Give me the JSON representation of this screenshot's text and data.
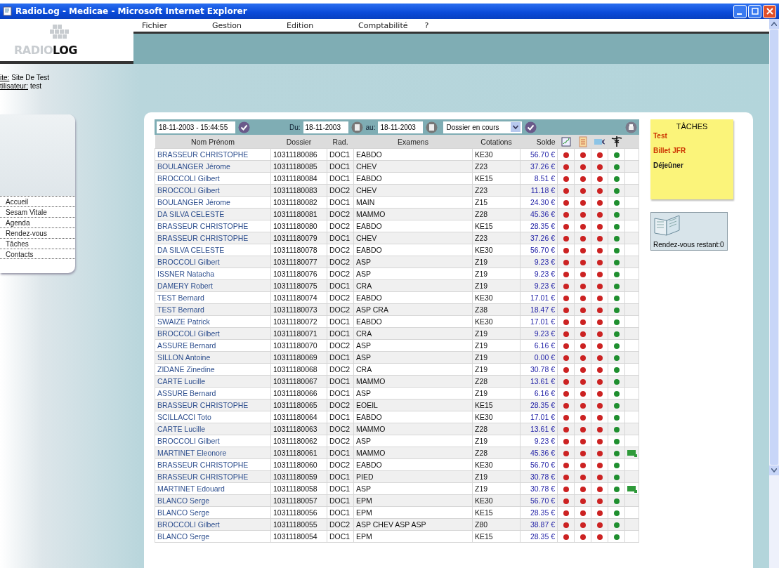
{
  "window": {
    "title": "RadioLog - Medicae - Microsoft Internet Explorer"
  },
  "menu": [
    "Fichier",
    "Gestion",
    "Edition",
    "Comptabilité",
    "?"
  ],
  "logo": {
    "light": "RADIO",
    "dark": "LOG"
  },
  "user_info": [
    {
      "label": "ite:",
      "value": "Site De Test"
    },
    {
      "label": "tilisateur:",
      "value": "test"
    }
  ],
  "nav": [
    "Accueil",
    "Sesam Vitale",
    "Agenda",
    "Rendez-vous",
    "Tâches",
    "Contacts"
  ],
  "filters": {
    "datetime": "18-11-2003 - 15:44:55",
    "from_label": "Du:",
    "from": "18-11-2003",
    "to_label": "au:",
    "to": "18-11-2003",
    "status": "Dossier en cours"
  },
  "table": {
    "columns": [
      "Nom Prénom",
      "Dossier",
      "Rad.",
      "Examens",
      "Cotations",
      "Solde"
    ],
    "rows": [
      {
        "name": "BRASSEUR CHRISTOPHE",
        "dossier": "10311180086",
        "rad": "DOC1",
        "examens": "EABDO",
        "cotations": "KE30",
        "solde": "56.70 €",
        "flags": [
          {
            "color": "#cc2222"
          },
          {
            "color": "#cc2222"
          },
          {
            "color": "#cc2222"
          },
          {
            "color": "#1f8f2f"
          }
        ],
        "card": false
      },
      {
        "name": "BOULANGER Jérome",
        "dossier": "10311180085",
        "rad": "DOC1",
        "examens": "CHEV",
        "cotations": "Z23",
        "solde": "37.26 €",
        "flags": [
          {
            "color": "#cc2222"
          },
          {
            "color": "#cc2222"
          },
          {
            "color": "#cc2222"
          },
          {
            "color": "#1f8f2f"
          }
        ],
        "card": false
      },
      {
        "name": "BROCCOLI Gilbert",
        "dossier": "10311180084",
        "rad": "DOC1",
        "examens": "EABDO",
        "cotations": "KE15",
        "solde": "8.51 €",
        "flags": [
          {
            "color": "#cc2222"
          },
          {
            "color": "#cc2222"
          },
          {
            "color": "#cc2222"
          },
          {
            "color": "#1f8f2f"
          }
        ],
        "card": false
      },
      {
        "name": "BROCCOLI Gilbert",
        "dossier": "10311180083",
        "rad": "DOC2",
        "examens": "CHEV",
        "cotations": "Z23",
        "solde": "11.18 €",
        "flags": [
          {
            "color": "#cc2222"
          },
          {
            "color": "#cc2222"
          },
          {
            "color": "#cc2222"
          },
          {
            "color": "#1f8f2f"
          }
        ],
        "card": false
      },
      {
        "name": "BOULANGER Jérome",
        "dossier": "10311180082",
        "rad": "DOC1",
        "examens": "MAIN",
        "cotations": "Z15",
        "solde": "24.30 €",
        "flags": [
          {
            "color": "#cc2222"
          },
          {
            "color": "#cc2222"
          },
          {
            "color": "#cc2222"
          },
          {
            "color": "#1f8f2f"
          }
        ],
        "card": false
      },
      {
        "name": "DA SILVA CELESTE",
        "dossier": "10311180081",
        "rad": "DOC2",
        "examens": "MAMMO",
        "cotations": "Z28",
        "solde": "45.36 €",
        "flags": [
          {
            "color": "#cc2222"
          },
          {
            "color": "#cc2222"
          },
          {
            "color": "#cc2222"
          },
          {
            "color": "#1f8f2f"
          }
        ],
        "card": false
      },
      {
        "name": "BRASSEUR CHRISTOPHE",
        "dossier": "10311180080",
        "rad": "DOC2",
        "examens": "EABDO",
        "cotations": "KE15",
        "solde": "28.35 €",
        "flags": [
          {
            "color": "#cc2222"
          },
          {
            "color": "#cc2222"
          },
          {
            "color": "#cc2222"
          },
          {
            "color": "#1f8f2f"
          }
        ],
        "card": false
      },
      {
        "name": "BRASSEUR CHRISTOPHE",
        "dossier": "10311180079",
        "rad": "DOC1",
        "examens": "CHEV",
        "cotations": "Z23",
        "solde": "37.26 €",
        "flags": [
          {
            "color": "#cc2222"
          },
          {
            "color": "#cc2222"
          },
          {
            "color": "#cc2222"
          },
          {
            "color": "#1f8f2f"
          }
        ],
        "card": false
      },
      {
        "name": "DA SILVA CELESTE",
        "dossier": "10311180078",
        "rad": "DOC2",
        "examens": "EABDO",
        "cotations": "KE30",
        "solde": "56.70 €",
        "flags": [
          {
            "color": "#cc2222"
          },
          {
            "color": "#cc2222"
          },
          {
            "color": "#cc2222"
          },
          {
            "color": "#1f8f2f"
          }
        ],
        "card": false
      },
      {
        "name": "BROCCOLI Gilbert",
        "dossier": "10311180077",
        "rad": "DOC2",
        "examens": "ASP",
        "cotations": "Z19",
        "solde": "9.23 €",
        "flags": [
          {
            "color": "#cc2222"
          },
          {
            "color": "#cc2222"
          },
          {
            "color": "#cc2222"
          },
          {
            "color": "#1f8f2f"
          }
        ],
        "card": false
      },
      {
        "name": "ISSNER Natacha",
        "dossier": "10311180076",
        "rad": "DOC2",
        "examens": "ASP",
        "cotations": "Z19",
        "solde": "9.23 €",
        "flags": [
          {
            "color": "#cc2222"
          },
          {
            "color": "#cc2222"
          },
          {
            "color": "#cc2222"
          },
          {
            "color": "#1f8f2f"
          }
        ],
        "card": false
      },
      {
        "name": "DAMERY Robert",
        "dossier": "10311180075",
        "rad": "DOC1",
        "examens": "CRA",
        "cotations": "Z19",
        "solde": "9.23 €",
        "flags": [
          {
            "color": "#cc2222"
          },
          {
            "color": "#cc2222"
          },
          {
            "color": "#cc2222"
          },
          {
            "color": "#1f8f2f"
          }
        ],
        "card": false
      },
      {
        "name": "TEST Bernard",
        "dossier": "10311180074",
        "rad": "DOC2",
        "examens": "EABDO",
        "cotations": "KE30",
        "solde": "17.01 €",
        "flags": [
          {
            "color": "#cc2222"
          },
          {
            "color": "#cc2222"
          },
          {
            "color": "#cc2222"
          },
          {
            "color": "#1f8f2f"
          }
        ],
        "card": false
      },
      {
        "name": "TEST Bernard",
        "dossier": "10311180073",
        "rad": "DOC2",
        "examens": "ASP CRA",
        "cotations": "Z38",
        "solde": "18.47 €",
        "flags": [
          {
            "color": "#cc2222"
          },
          {
            "color": "#cc2222"
          },
          {
            "color": "#cc2222"
          },
          {
            "color": "#1f8f2f"
          }
        ],
        "card": false
      },
      {
        "name": "SWAIZE Patrick",
        "dossier": "10311180072",
        "rad": "DOC1",
        "examens": "EABDO",
        "cotations": "KE30",
        "solde": "17.01 €",
        "flags": [
          {
            "color": "#cc2222"
          },
          {
            "color": "#cc2222"
          },
          {
            "color": "#cc2222"
          },
          {
            "color": "#1f8f2f"
          }
        ],
        "card": false
      },
      {
        "name": "BROCCOLI Gilbert",
        "dossier": "10311180071",
        "rad": "DOC1",
        "examens": "CRA",
        "cotations": "Z19",
        "solde": "9.23 €",
        "flags": [
          {
            "color": "#cc2222"
          },
          {
            "color": "#cc2222"
          },
          {
            "color": "#cc2222"
          },
          {
            "color": "#1f8f2f"
          }
        ],
        "card": false
      },
      {
        "name": "ASSURE Bernard",
        "dossier": "10311180070",
        "rad": "DOC2",
        "examens": "ASP",
        "cotations": "Z19",
        "solde": "6.16 €",
        "flags": [
          {
            "color": "#cc2222"
          },
          {
            "color": "#cc2222"
          },
          {
            "color": "#cc2222"
          },
          {
            "color": "#1f8f2f"
          }
        ],
        "card": false
      },
      {
        "name": "SILLON Antoine",
        "dossier": "10311180069",
        "rad": "DOC1",
        "examens": "ASP",
        "cotations": "Z19",
        "solde": "0.00 €",
        "flags": [
          {
            "color": "#cc2222"
          },
          {
            "color": "#cc2222"
          },
          {
            "color": "#cc2222"
          },
          {
            "color": "#1f8f2f"
          }
        ],
        "card": false
      },
      {
        "name": "ZIDANE Zinedine",
        "dossier": "10311180068",
        "rad": "DOC2",
        "examens": "CRA",
        "cotations": "Z19",
        "solde": "30.78 €",
        "flags": [
          {
            "color": "#cc2222"
          },
          {
            "color": "#cc2222"
          },
          {
            "color": "#cc2222"
          },
          {
            "color": "#1f8f2f"
          }
        ],
        "card": false
      },
      {
        "name": "CARTE Lucille",
        "dossier": "10311180067",
        "rad": "DOC1",
        "examens": "MAMMO",
        "cotations": "Z28",
        "solde": "13.61 €",
        "flags": [
          {
            "color": "#cc2222"
          },
          {
            "color": "#cc2222"
          },
          {
            "color": "#cc2222"
          },
          {
            "color": "#1f8f2f"
          }
        ],
        "card": false
      },
      {
        "name": "ASSURE Bernard",
        "dossier": "10311180066",
        "rad": "DOC1",
        "examens": "ASP",
        "cotations": "Z19",
        "solde": "6.16 €",
        "flags": [
          {
            "color": "#cc2222"
          },
          {
            "color": "#cc2222"
          },
          {
            "color": "#cc2222"
          },
          {
            "color": "#1f8f2f"
          }
        ],
        "card": false
      },
      {
        "name": "BRASSEUR CHRISTOPHE",
        "dossier": "10311180065",
        "rad": "DOC2",
        "examens": "EOEIL",
        "cotations": "KE15",
        "solde": "28.35 €",
        "flags": [
          {
            "color": "#cc2222"
          },
          {
            "color": "#cc2222"
          },
          {
            "color": "#cc2222"
          },
          {
            "color": "#1f8f2f"
          }
        ],
        "card": false
      },
      {
        "name": "SCILLACCI Toto",
        "dossier": "10311180064",
        "rad": "DOC1",
        "examens": "EABDO",
        "cotations": "KE30",
        "solde": "17.01 €",
        "flags": [
          {
            "color": "#cc2222"
          },
          {
            "color": "#cc2222"
          },
          {
            "color": "#cc2222"
          },
          {
            "color": "#1f8f2f"
          }
        ],
        "card": false
      },
      {
        "name": "CARTE Lucille",
        "dossier": "10311180063",
        "rad": "DOC2",
        "examens": "MAMMO",
        "cotations": "Z28",
        "solde": "13.61 €",
        "flags": [
          {
            "color": "#cc2222"
          },
          {
            "color": "#cc2222"
          },
          {
            "color": "#cc2222"
          },
          {
            "color": "#1f8f2f"
          }
        ],
        "card": false
      },
      {
        "name": "BROCCOLI Gilbert",
        "dossier": "10311180062",
        "rad": "DOC2",
        "examens": "ASP",
        "cotations": "Z19",
        "solde": "9.23 €",
        "flags": [
          {
            "color": "#cc2222"
          },
          {
            "color": "#cc2222"
          },
          {
            "color": "#cc2222"
          },
          {
            "color": "#1f8f2f"
          }
        ],
        "card": false
      },
      {
        "name": "MARTINET Eleonore",
        "dossier": "10311180061",
        "rad": "DOC1",
        "examens": "MAMMO",
        "cotations": "Z28",
        "solde": "45.36 €",
        "flags": [
          {
            "color": "#cc2222"
          },
          {
            "color": "#cc2222"
          },
          {
            "color": "#cc2222"
          },
          {
            "color": "#1f8f2f"
          }
        ],
        "card": true
      },
      {
        "name": "BRASSEUR CHRISTOPHE",
        "dossier": "10311180060",
        "rad": "DOC2",
        "examens": "EABDO",
        "cotations": "KE30",
        "solde": "56.70 €",
        "flags": [
          {
            "color": "#cc2222"
          },
          {
            "color": "#cc2222"
          },
          {
            "color": "#cc2222"
          },
          {
            "color": "#1f8f2f"
          }
        ],
        "card": false
      },
      {
        "name": "BRASSEUR CHRISTOPHE",
        "dossier": "10311180059",
        "rad": "DOC1",
        "examens": "PIED",
        "cotations": "Z19",
        "solde": "30.78 €",
        "flags": [
          {
            "color": "#cc2222"
          },
          {
            "color": "#cc2222"
          },
          {
            "color": "#cc2222"
          },
          {
            "color": "#1f8f2f"
          }
        ],
        "card": false
      },
      {
        "name": "MARTINET Edouard",
        "dossier": "10311180058",
        "rad": "DOC1",
        "examens": "ASP",
        "cotations": "Z19",
        "solde": "30.78 €",
        "flags": [
          {
            "color": "#cc2222"
          },
          {
            "color": "#cc2222"
          },
          {
            "color": "#cc2222"
          },
          {
            "color": "#1f8f2f"
          }
        ],
        "card": true
      },
      {
        "name": "BLANCO Serge",
        "dossier": "10311180057",
        "rad": "DOC1",
        "examens": "EPM",
        "cotations": "KE30",
        "solde": "56.70 €",
        "flags": [
          {
            "color": "#cc2222"
          },
          {
            "color": "#cc2222"
          },
          {
            "color": "#cc2222"
          },
          {
            "color": "#1f8f2f"
          }
        ],
        "card": false
      },
      {
        "name": "BLANCO Serge",
        "dossier": "10311180056",
        "rad": "DOC1",
        "examens": "EPM",
        "cotations": "KE15",
        "solde": "28.35 €",
        "flags": [
          {
            "color": "#cc2222"
          },
          {
            "color": "#cc2222"
          },
          {
            "color": "#cc2222"
          },
          {
            "color": "#1f8f2f"
          }
        ],
        "card": false
      },
      {
        "name": "BROCCOLI Gilbert",
        "dossier": "10311180055",
        "rad": "DOC2",
        "examens": "ASP CHEV ASP ASP",
        "cotations": "Z80",
        "solde": "38.87 €",
        "flags": [
          {
            "color": "#cc2222"
          },
          {
            "color": "#cc2222"
          },
          {
            "color": "#cc2222"
          },
          {
            "color": "#1f8f2f"
          }
        ],
        "card": false
      },
      {
        "name": "BLANCO Serge",
        "dossier": "10311180054",
        "rad": "DOC1",
        "examens": "EPM",
        "cotations": "KE15",
        "solde": "28.35 €",
        "flags": [
          {
            "color": "#cc2222"
          },
          {
            "color": "#cc2222"
          },
          {
            "color": "#cc2222"
          },
          {
            "color": "#1f8f2f"
          }
        ],
        "card": false
      }
    ]
  },
  "tasks": {
    "title": "TÂCHES",
    "items": [
      {
        "text": "Test",
        "color": "#cc3300"
      },
      {
        "text": "Billet JFR",
        "color": "#cc3300"
      },
      {
        "text": "Déjeûner",
        "color": "#222222"
      }
    ]
  },
  "appointments": {
    "text": "Rendez-vous restant:0"
  }
}
